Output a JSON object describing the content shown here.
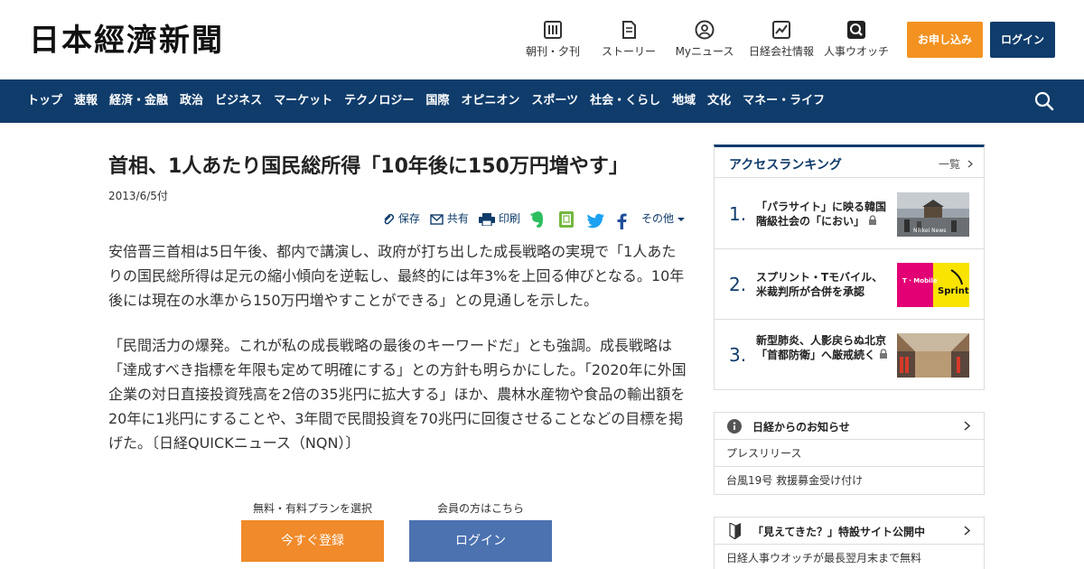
{
  "header": {
    "logo": "日本經濟新聞",
    "nav": [
      {
        "label": "朝刊・夕刊",
        "icon": "newspaper-icon"
      },
      {
        "label": "ストーリー",
        "icon": "document-icon"
      },
      {
        "label": "Myニュース",
        "icon": "user-icon"
      },
      {
        "label": "日経会社情報",
        "icon": "chart-icon"
      },
      {
        "label": "人事ウオッチ",
        "icon": "magnifier-icon"
      }
    ],
    "apply_label": "お申し込み",
    "login_label": "ログイン"
  },
  "navbar": {
    "items": [
      "トップ",
      "速報",
      "経済・金融",
      "政治",
      "ビジネス",
      "マーケット",
      "テクノロジー",
      "国際",
      "オピニオン",
      "スポーツ",
      "社会・くらし",
      "地域",
      "文化",
      "マネー・ライフ"
    ]
  },
  "article": {
    "headline": "首相、1人あたり国民総所得「10年後に150万円増やす」",
    "date": "2013/6/5付",
    "tools": {
      "save": "保存",
      "share": "共有",
      "print": "印刷",
      "more": "その他"
    },
    "paragraphs": [
      "安倍晋三首相は5日午後、都内で講演し、政府が打ち出した成長戦略の実現で「1人あたりの国民総所得は足元の縮小傾向を逆転し、最終的には年3%を上回る伸びとなる。10年後には現在の水準から150万円増やすことができる」との見通しを示した。",
      "「民間活力の爆発。これが私の成長戦略の最後のキーワードだ」とも強調。成長戦略は「達成すべき指標を年限も定めて明確にする」との方針も明らかにした。「2020年に外国企業の対日直接投資残高を2倍の35兆円に拡大する」ほか、農林水産物や食品の輸出額を20年に1兆円にすることや、3年間で民間投資を70兆円に回復させることなどの目標を掲げた。〔日経QUICKニュース（NQN）〕"
    ],
    "cta": {
      "register_caption": "無料・有料プランを選択",
      "register_label": "今すぐ登録",
      "login_caption": "会員の方はこちら",
      "login_label": "ログイン"
    }
  },
  "sidebar": {
    "ranking": {
      "title": "アクセスランキング",
      "all_link": "一覧",
      "items": [
        {
          "rank": "1.",
          "text": "「パラサイト」に映る韓国 階級社会の「におい」",
          "thumb": "korea-street-photo"
        },
        {
          "rank": "2.",
          "text": "スプリント・Tモバイル、米裁判所が合併を承認",
          "thumb": "sprint-tmobile-logo-photo"
        },
        {
          "rank": "3.",
          "text": "新型肺炎、人影戻らぬ北京 「首都防衛」へ厳戒続く",
          "thumb": "beijing-subway-photo"
        }
      ]
    },
    "notices": {
      "title": "日経からのお知らせ",
      "rows": [
        "プレスリリース",
        "台風19号 救援募金受け付け"
      ]
    },
    "promo": {
      "title": "「見えてきた？」特設サイト公開中",
      "rows": [
        "日経人事ウオッチが最長翌月末まで無料"
      ]
    }
  },
  "colors": {
    "navy": "#0f3c6b",
    "orange": "#f39221",
    "cta_blue": "#4c72b0"
  }
}
